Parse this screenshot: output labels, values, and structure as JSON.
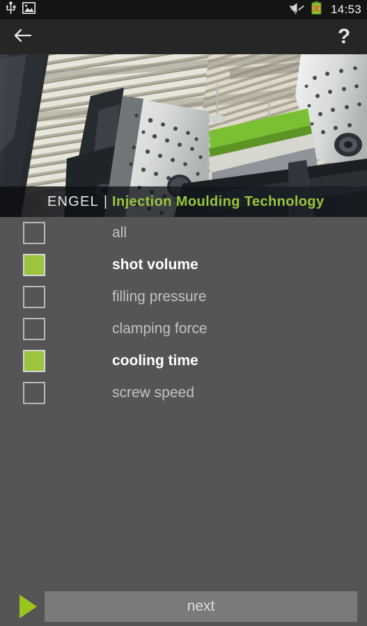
{
  "status_bar": {
    "icons_left": [
      "usb-icon",
      "screenshot-image-icon"
    ],
    "icons_right": [
      "volume-mute-icon",
      "battery-error-icon"
    ],
    "clock": "14:53"
  },
  "action_bar": {
    "back_label": "back-arrow-icon",
    "help_label": "?"
  },
  "hero": {
    "brand": "ENGEL",
    "separator": "|",
    "tagline": "Injection Moulding Technology",
    "image_alt": "injection-moulding-machine-factory-photo"
  },
  "options": {
    "items": [
      {
        "label": "all",
        "checked": false
      },
      {
        "label": "shot volume",
        "checked": true
      },
      {
        "label": "filling pressure",
        "checked": false
      },
      {
        "label": "clamping force",
        "checked": false
      },
      {
        "label": "cooling time",
        "checked": true
      },
      {
        "label": "screw speed",
        "checked": false
      }
    ]
  },
  "footer": {
    "next_label": "next",
    "arrow_icon": "play-triangle-icon"
  },
  "colors": {
    "accent_green": "#9ac53c",
    "arrow_green": "#9ac51a",
    "background": "#555555",
    "action_bar": "#262626",
    "status_bar": "#141414",
    "button_gray": "#7a7a7a"
  }
}
